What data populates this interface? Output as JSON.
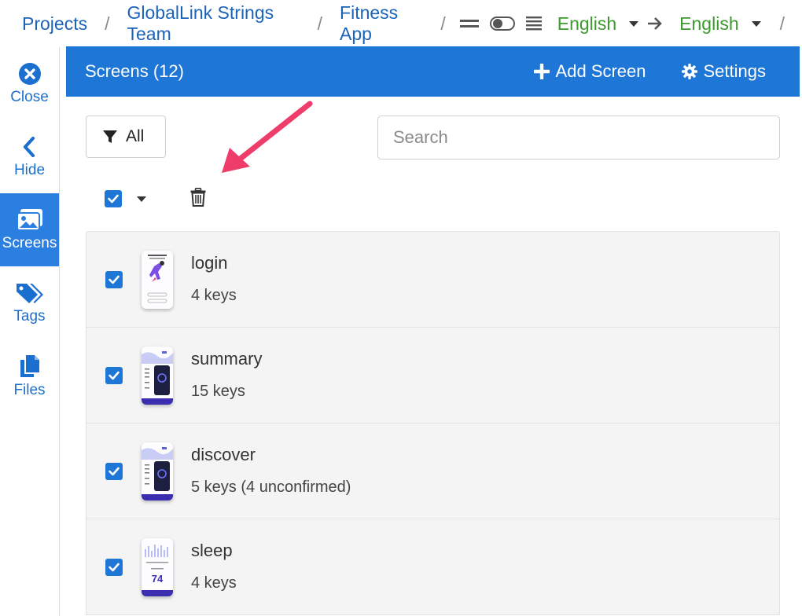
{
  "breadcrumb": {
    "items": [
      "Projects",
      "GlobalLink Strings Team",
      "Fitness App"
    ],
    "separator": "/",
    "source_language": "English",
    "target_language": "English"
  },
  "sidebar": {
    "items": [
      {
        "label": "Close",
        "icon": "close-circle-icon"
      },
      {
        "label": "Hide",
        "icon": "chevron-left-icon"
      },
      {
        "label": "Screens",
        "icon": "images-icon",
        "active": true
      },
      {
        "label": "Tags",
        "icon": "tags-icon"
      },
      {
        "label": "Files",
        "icon": "files-icon"
      }
    ]
  },
  "panel": {
    "title": "Screens (12)",
    "add_label": "Add Screen",
    "settings_label": "Settings",
    "filter_label": "All",
    "search_placeholder": "Search"
  },
  "screens": [
    {
      "name": "login",
      "keys": "4 keys",
      "checked": true
    },
    {
      "name": "summary",
      "keys": "15 keys",
      "checked": true
    },
    {
      "name": "discover",
      "keys": "5 keys (4 unconfirmed)",
      "checked": true
    },
    {
      "name": "sleep",
      "keys": "4 keys",
      "checked": true
    }
  ],
  "colors": {
    "accent": "#1e76d6",
    "link": "#1b63b8",
    "language": "#3d9a2f",
    "annotation_arrow": "#ef3d6b"
  }
}
